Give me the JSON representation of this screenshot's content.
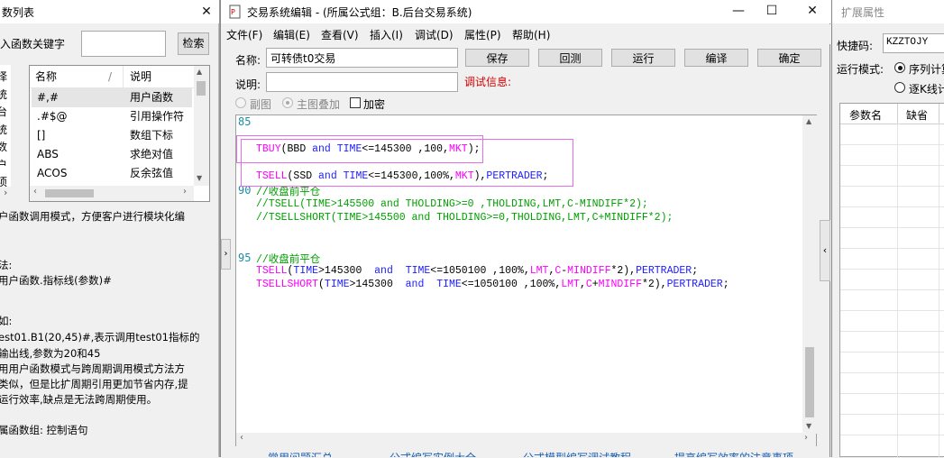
{
  "left_window": {
    "title": "数列表",
    "search_label": "入函数关键字",
    "search_value": "",
    "search_button": "检索",
    "side_chars": [
      "择",
      "统",
      "台",
      "统",
      "数",
      "户",
      "项"
    ],
    "columns": {
      "name": "名称",
      "sort": "/",
      "desc": "说明"
    },
    "rows": [
      {
        "name": "#,#",
        "desc": "用户函数"
      },
      {
        "name": ".#$@",
        "desc": "引用操作符"
      },
      {
        "name": "[]",
        "desc": "数组下标"
      },
      {
        "name": "ABS",
        "desc": "求绝对值"
      },
      {
        "name": "ACOS",
        "desc": "反余弦值"
      }
    ],
    "description_lines": [
      "户函数调用模式，方便客户进行模块化编",
      "",
      "",
      "法:",
      "用户函数.指标线(参数)#",
      "",
      "",
      "如:",
      "est01.B1(20,45)#,表示调用test01指标的",
      "输出线,参数为20和45",
      "用用户函数模式与跨周期调用模式方法方",
      "类似，但是比扩周期引用更加节省内存,提",
      "运行效率,缺点是无法跨周期使用。",
      "",
      "",
      "属函数组: 控制语句"
    ]
  },
  "editor_window": {
    "title": "交易系统编辑 - (所属公式组：B.后台交易系统)",
    "menu": [
      "文件(F)",
      "编辑(E)",
      "查看(V)",
      "插入(I)",
      "调试(D)",
      "属性(P)",
      "帮助(H)"
    ],
    "name_label": "名称:",
    "name_value": "可转债t0交易",
    "desc_label": "说明:",
    "desc_value": "",
    "debug_label": "调试信息:",
    "buttons": [
      "保存",
      "回测",
      "运行",
      "编译",
      "确定"
    ],
    "radio_sub": "副图",
    "radio_main": "主图叠加",
    "encrypt_label": "加密",
    "line_numbers": [
      "85",
      "90",
      "95"
    ],
    "code_lines": {
      "l1": {
        "a": "TBUY",
        "b": "(BBD ",
        "c": "and",
        "d": " ",
        "e": "TIME",
        "f": "<=145300 ,100,",
        "g": "MKT",
        "h": ");"
      },
      "l2": {
        "a": "TSELL",
        "b": "(SSD ",
        "c": "and",
        "d": " ",
        "e": "TIME",
        "f": "<=145300,100%,",
        "g": "MKT",
        "h": "),",
        "i": "PERTRADER",
        "j": ";"
      },
      "l3": "//收盘前平仓",
      "l4": "//TSELL(TIME>145500 and THOLDING>=0 ,THOLDING,LMT,C-MINDIFF*2);",
      "l5": "//TSELLSHORT(TIME>145500 and THOLDING>=0,THOLDING,LMT,C+MINDIFF*2);",
      "l6": "//收盘前平仓",
      "l7": {
        "a": "TSELL",
        "b": "(",
        "c": "TIME",
        "d": ">145300  ",
        "e": "and",
        "f": "  ",
        "g": "TIME",
        "h": "<=1050100 ,100%,",
        "i": "LMT",
        "j": ",",
        "k": "C",
        "l": "-",
        "m": "MINDIFF",
        "n": "*2),",
        "o": "PERTRADER",
        "p": ";"
      },
      "l8": {
        "a": "TSELLSHORT",
        "b": "(",
        "c": "TIME",
        "d": ">145300  ",
        "e": "and",
        "f": "  ",
        "g": "TIME",
        "h": "<=1050100 ,100%,",
        "i": "LMT",
        "j": ",",
        "k": "C",
        "l": "+",
        "m": "MINDIFF",
        "n": "*2),",
        "o": "PERTRADER",
        "p": ";"
      }
    },
    "bottom_links": [
      "常用问题汇总",
      "公式编写实例大全",
      "公式模型编写调试教程",
      "提高编写效率的注意事项"
    ],
    "colors": {
      "keyword": "#1c1cff",
      "function": "#ff00ff",
      "comment": "#00a000",
      "highlight_box": "#e46ee8"
    }
  },
  "right_window": {
    "title": "扩展属性",
    "shortcut_label": "快捷码:",
    "shortcut_value": "KZZTOJY",
    "mode_label": "运行模式:",
    "mode_options": [
      "序列计算",
      "逐K线计算"
    ],
    "table_columns": [
      "参数名",
      "缺省"
    ]
  }
}
